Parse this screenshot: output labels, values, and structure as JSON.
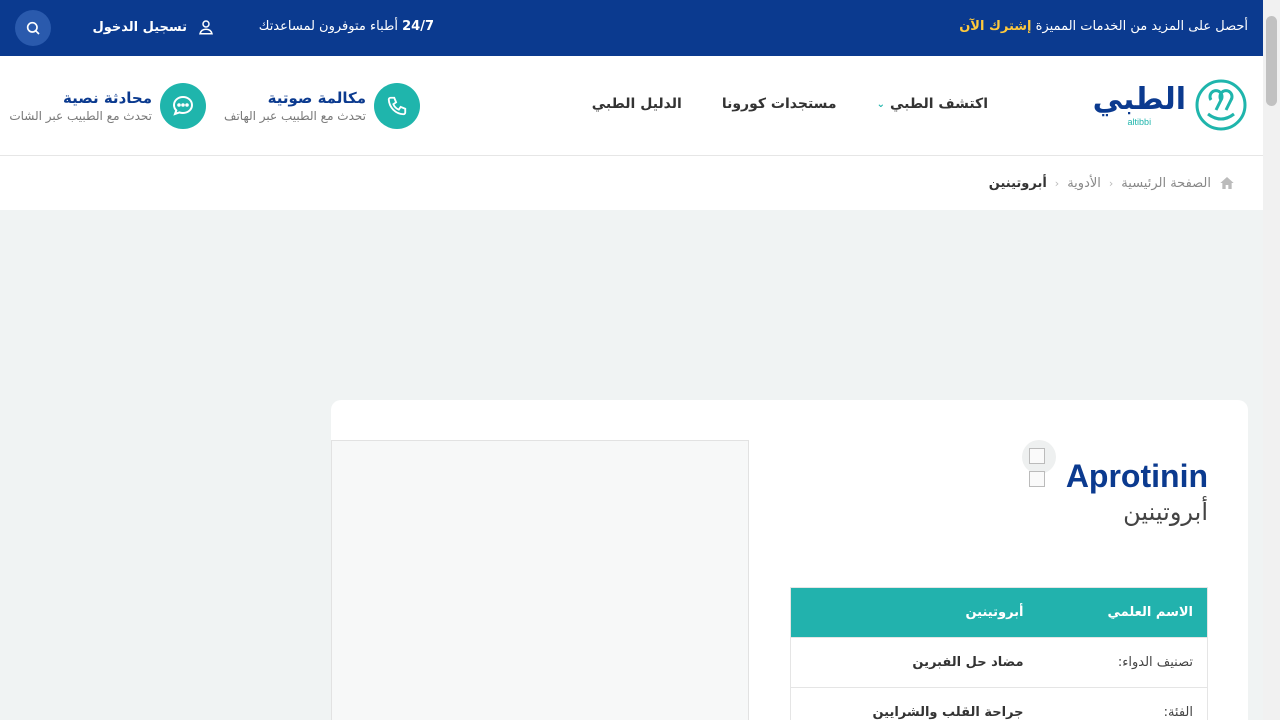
{
  "topbar": {
    "promo_text": "أحصل على المزيد من الخدمات المميزة",
    "promo_cta": "إشترك الآن",
    "availability_prefix": "24/7",
    "availability_text": "أطباء متوفرون لمساعدتك",
    "login_label": "تسجيل الدخول"
  },
  "header": {
    "logo_ar": "الطبي",
    "logo_en": "altibbi",
    "nav": {
      "explore": "اكتشف الطبي",
      "corona": "مستجدات كورونا",
      "guide": "الدليل الطبي"
    },
    "call": {
      "title": "مكالمة صوتية",
      "subtitle": "تحدث مع الطبيب عبر الهاتف"
    },
    "chat": {
      "title": "محادثة نصية",
      "subtitle": "تحدث مع الطبيب عبر الشات"
    }
  },
  "breadcrumb": {
    "home": "الصفحة الرئيسية",
    "medicines": "الأدوية",
    "current": "أبروتينين"
  },
  "drug": {
    "name_en": "Aprotinin",
    "name_ar": "أبروتينين",
    "rows": [
      {
        "key": "الاسم العلمي",
        "value": "أبروتينين"
      },
      {
        "key": "تصنيف الدواء:",
        "value": "مضاد حل الفبرين"
      },
      {
        "key": "الفئة:",
        "value": "جراحة القلب والشرايين"
      }
    ]
  },
  "colors": {
    "primary": "#0b3a8f",
    "accent": "#1fb5ac",
    "highlight": "#ffc93c"
  }
}
